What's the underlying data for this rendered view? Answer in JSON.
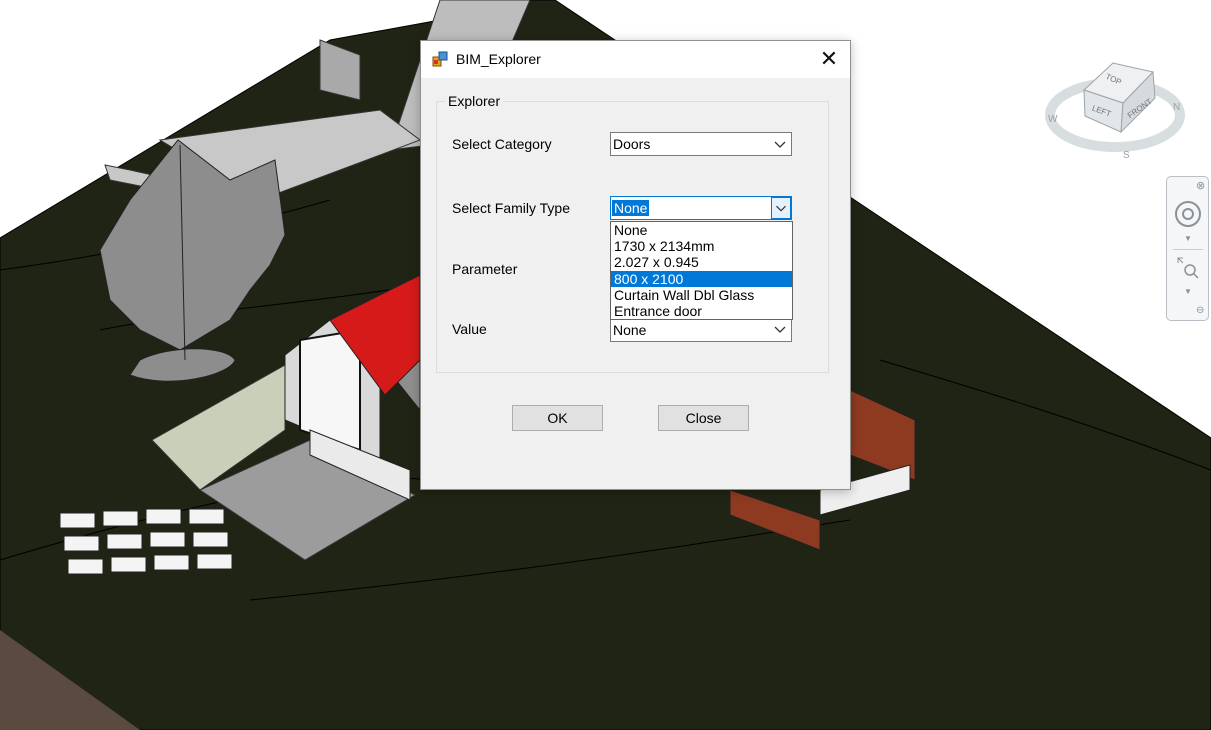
{
  "dialog": {
    "title": "BIM_Explorer",
    "close_glyph": "✕",
    "group_label": "Explorer",
    "category": {
      "label": "Select Category",
      "value": "Doors"
    },
    "family_type": {
      "label": "Select Family Type",
      "value": "None",
      "options": [
        "None",
        "1730 x 2134mm",
        "2.027 x 0.945",
        "800 x 2100",
        "Curtain Wall Dbl Glass",
        "Entrance door"
      ],
      "highlighted_option": "800 x 2100"
    },
    "parameter": {
      "label": "Parameter",
      "value": ""
    },
    "value_field": {
      "label": "Value",
      "value": "None"
    },
    "buttons": {
      "ok": "OK",
      "close": "Close"
    }
  },
  "viewcube": {
    "faces": [
      "TOP",
      "LEFT",
      "FRONT"
    ],
    "compass": [
      "W",
      "S",
      "N"
    ]
  },
  "colors": {
    "ground": "#1f2414",
    "roof": "#d61a1a",
    "accent": "#0078d7",
    "dialog_bg": "#f0f0f0",
    "cladding": "#8e3a21"
  },
  "icons": [
    "app-icon",
    "close-icon",
    "chevron-down-icon",
    "steering-wheel-icon",
    "zoom-icon"
  ]
}
